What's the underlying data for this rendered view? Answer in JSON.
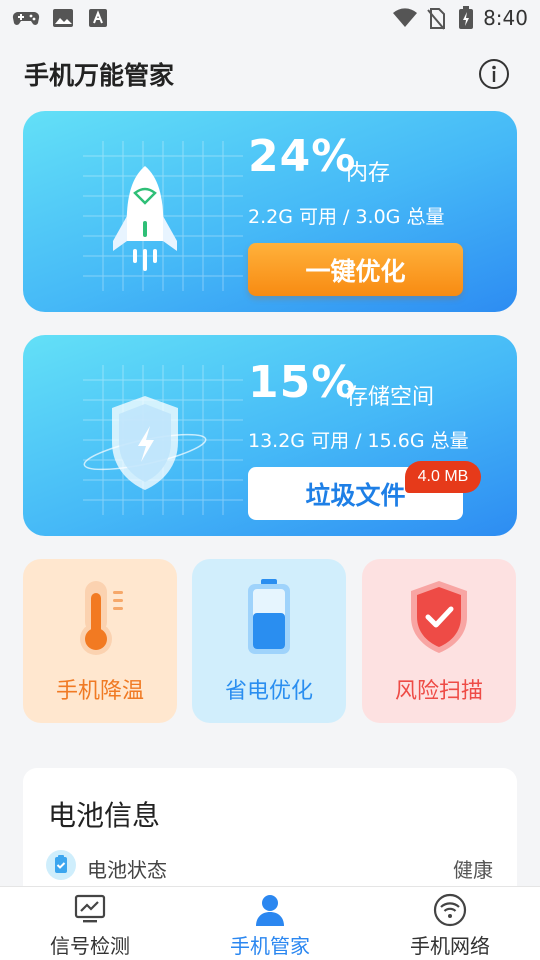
{
  "status_bar": {
    "time": "8:40",
    "icons": [
      "gamepad-icon",
      "image-icon",
      "a-icon",
      "wifi-icon",
      "no-sim-icon",
      "battery-charging-icon"
    ]
  },
  "app_bar": {
    "title": "手机万能管家",
    "info_icon": "info-icon"
  },
  "memory_card": {
    "percent": "24%",
    "label": "内存",
    "capacity": "2.2G 可用 / 3.0G 总量",
    "button": "一键优化",
    "icon": "rocket-icon",
    "used_fraction": 0.24
  },
  "storage_card": {
    "percent": "15%",
    "label": "存储空间",
    "capacity": "13.2G 可用 / 15.6G 总量",
    "button": "垃圾文件",
    "badge": "4.0 MB",
    "icon": "shield-bolt-icon",
    "used_fraction": 0.15
  },
  "tiles": [
    {
      "label": "手机降温",
      "icon": "thermometer-icon",
      "color": "#f27a22"
    },
    {
      "label": "省电优化",
      "icon": "battery-icon",
      "color": "#2a8ef0"
    },
    {
      "label": "风险扫描",
      "icon": "shield-check-icon",
      "color": "#ee4b46"
    }
  ],
  "battery_info": {
    "title": "电池信息",
    "rows": [
      {
        "label": "电池状态",
        "value": "健康",
        "icon": "clipboard-check-icon"
      }
    ]
  },
  "bottom_nav": [
    {
      "label": "信号检测",
      "icon": "monitor-chart-icon",
      "active": false
    },
    {
      "label": "手机管家",
      "icon": "person-icon",
      "active": true
    },
    {
      "label": "手机网络",
      "icon": "wifi-circle-icon",
      "active": false
    }
  ],
  "colors": {
    "accent_blue": "#2b87f0",
    "orange": "#f88b12",
    "badge_red": "#e63a1a"
  }
}
